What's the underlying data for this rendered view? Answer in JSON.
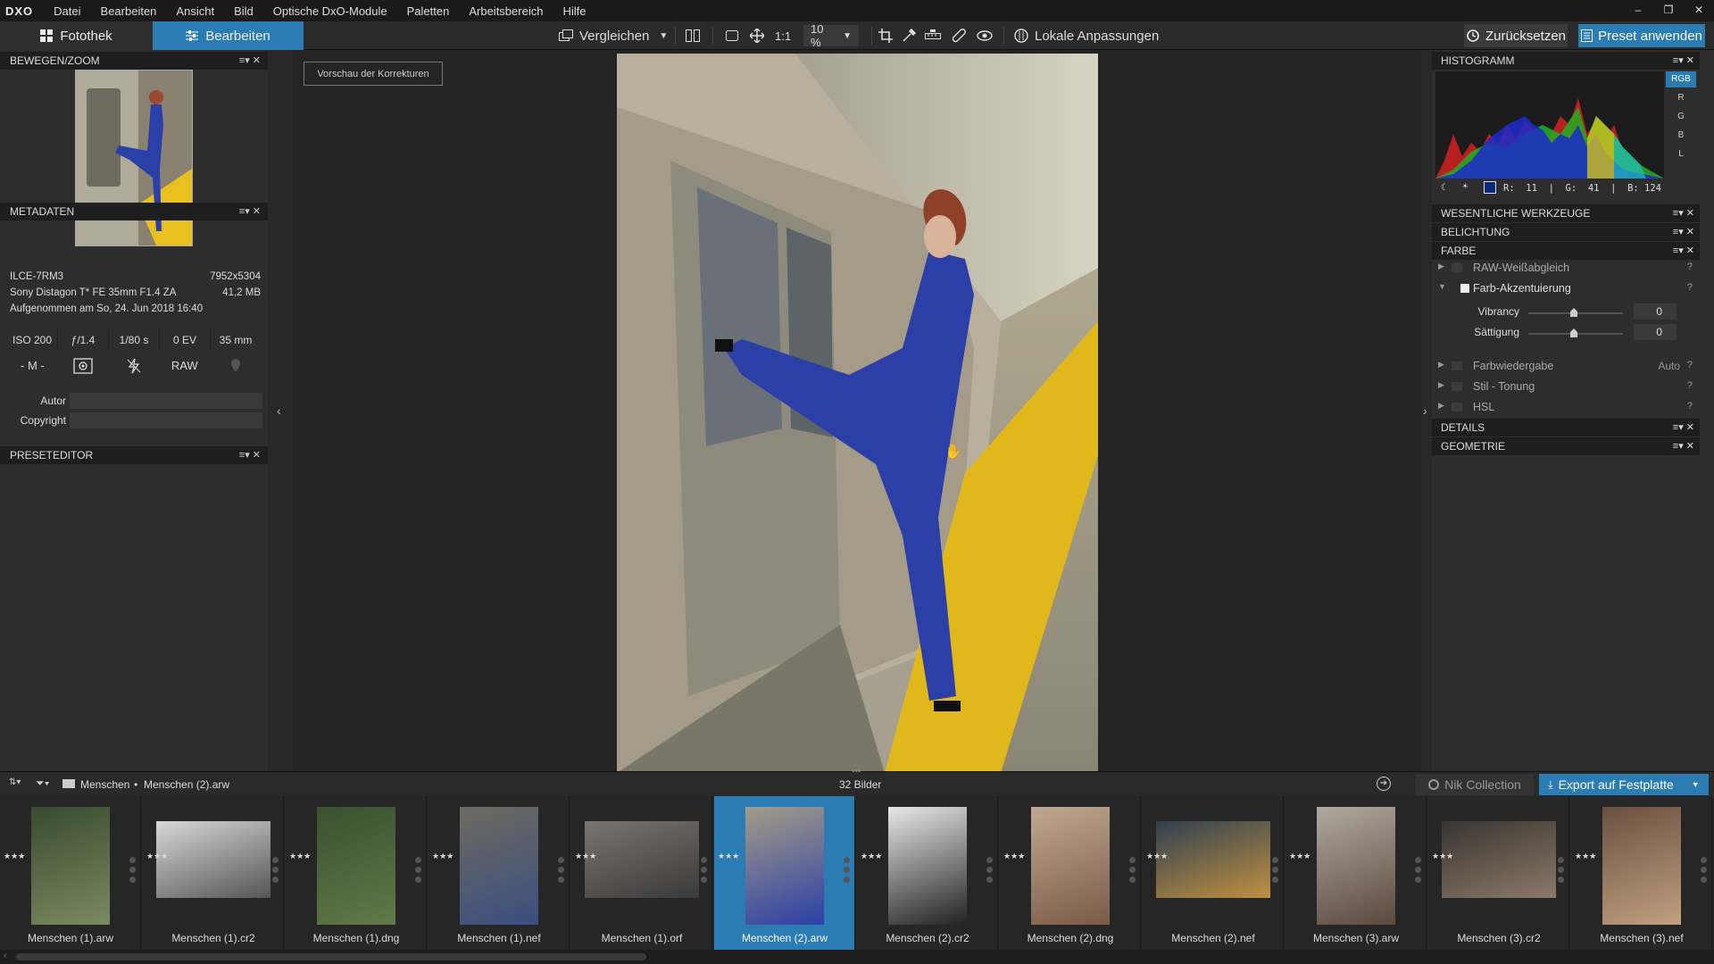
{
  "app": {
    "logo": "DXO"
  },
  "menu": [
    "Datei",
    "Bearbeiten",
    "Ansicht",
    "Bild",
    "Optische DxO-Module",
    "Paletten",
    "Arbeitsbereich",
    "Hilfe"
  ],
  "window_controls": {
    "minimize": "–",
    "restore": "❐",
    "close": "✕"
  },
  "tabs": {
    "library": "Fotothek",
    "edit": "Bearbeiten"
  },
  "toolbar": {
    "compare": "Vergleichen",
    "one_to_one": "1:1",
    "zoom": "10 %",
    "local_adjustments": "Lokale Anpassungen",
    "reset": "Zurücksetzen",
    "apply_preset": "Preset anwenden"
  },
  "left": {
    "move_zoom": "BEWEGEN/ZOOM",
    "metadata_title": "METADATEN",
    "camera": "ILCE-7RM3",
    "resolution": "7952x5304",
    "lens": "Sony Distagon T* FE 35mm F1.4 ZA",
    "filesize": "41,2 MB",
    "taken": "Aufgenommen am So, 24. Jun 2018 16:40",
    "exif": {
      "iso": "ISO 200",
      "aperture": "ƒ/1.4",
      "shutter": "1/80 s",
      "ev": "0 EV",
      "focal": "35 mm"
    },
    "mode": "- M -",
    "format": "RAW",
    "author_label": "Autor",
    "copyright_label": "Copyright",
    "preset_editor": "PRESETEDITOR"
  },
  "center": {
    "preview_button": "Vorschau der Korrekturen"
  },
  "right": {
    "histogram_title": "HISTOGRAMM",
    "channels": [
      "RGB",
      "R",
      "G",
      "B",
      "L"
    ],
    "readout": "R:  11  |  G:  41  |  B: 124",
    "sample_color": "#0b297c",
    "sections": {
      "essential": "WESENTLICHE WERKZEUGE",
      "exposure": "BELICHTUNG",
      "color": "FARBE",
      "details": "DETAILS",
      "geometry": "GEOMETRIE"
    },
    "color_items": {
      "raw_wb": "RAW-Weißabgleich",
      "accent": "Farb-Akzentuierung",
      "vibrancy_label": "Vibrancy",
      "vibrancy_value": "0",
      "saturation_label": "Sättigung",
      "saturation_value": "0",
      "rendering": "Farbwiedergabe",
      "rendering_value": "Auto",
      "style": "Stil - Tonung",
      "hsl": "HSL"
    },
    "help": "?"
  },
  "filmbar": {
    "folder": "Menschen",
    "file": "Menschen (2).arw",
    "count": "32 Bilder",
    "nik": "Nik Collection",
    "export": "Export auf Festplatte"
  },
  "thumbnails": [
    {
      "name": "Menschen (1).arw"
    },
    {
      "name": "Menschen (1).cr2"
    },
    {
      "name": "Menschen (1).dng"
    },
    {
      "name": "Menschen (1).nef"
    },
    {
      "name": "Menschen (1).orf"
    },
    {
      "name": "Menschen (2).arw"
    },
    {
      "name": "Menschen (2).cr2"
    },
    {
      "name": "Menschen (2).dng"
    },
    {
      "name": "Menschen (2).nef"
    },
    {
      "name": "Menschen (3).arw"
    },
    {
      "name": "Menschen (3).cr2"
    },
    {
      "name": "Menschen (3).nef"
    }
  ],
  "colors": {
    "accent": "#2b7cb3",
    "panel": "#2d2d2d",
    "header": "#1e1e1e"
  }
}
